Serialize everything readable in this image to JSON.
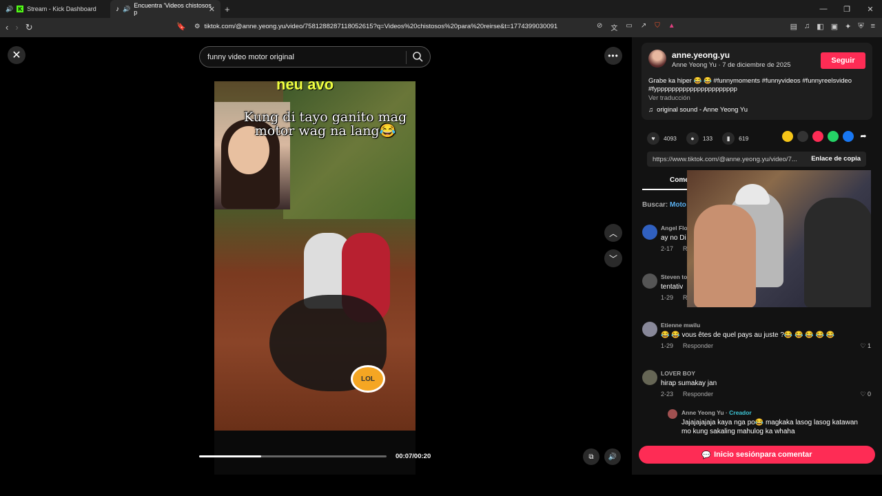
{
  "browser": {
    "tabs": [
      {
        "label": "Stream - Kick Dashboard",
        "icon": "kick-icon"
      },
      {
        "label": "Encuentra 'Videos chistosos p",
        "icon": "tiktok-icon"
      }
    ],
    "url": "tiktok.com/@anne.yeong.yu/video/7581288287118052615?q=Videos%20chistosos%20para%20reirse&t=1774399030091"
  },
  "player": {
    "search_value": "funny video motor original",
    "video_top_caption": "neu avo",
    "video_caption": "Kung di tayo ganito mag motor wag na lang😂",
    "time": "00:07/00:20",
    "progress_fraction": 0.33,
    "sticker_text": "LOL"
  },
  "panel": {
    "username": "anne.yeong.yu",
    "meta": "Anne Yeong Yu · 7 de diciembre de 2025",
    "follow_label": "Seguir",
    "description": "Grabe ka hiper 😂 😂 #funnymoments #funnyvideos #funnyreelsvideo #fypppppppppppppppppppppp",
    "translate_label": "Ver traducción",
    "sound": "original sound - Anne Yeong Yu",
    "likes": "4093",
    "comments": "133",
    "saves": "619",
    "link": "https://www.tiktok.com/@anne.yeong.yu/video/7...",
    "copy_label": "Enlace de copia",
    "tab_label": "Come",
    "search_prefix": "Buscar:",
    "search_term": "Moto",
    "comment_list": [
      {
        "author": "Angel Flo",
        "text": "ay no Di",
        "date": "2-17",
        "reply": "Res",
        "likes": ""
      },
      {
        "author": "Steven to",
        "text": "tentativ",
        "date": "1-29",
        "reply": "Res",
        "likes": ""
      },
      {
        "author": "Etienne mwilu",
        "text": "😂 😂 vous êtes de quel pays au juste ?😂 😂 😂 😂 😂",
        "date": "1-29",
        "reply": "Responder",
        "likes": "1"
      },
      {
        "author": "LOVER BOY",
        "text": "hirap sumakay jan",
        "date": "2-23",
        "reply": "Responder",
        "likes": "0"
      }
    ],
    "creator_reply": {
      "author": "Anne Yeong Yu",
      "tag": "Creador",
      "text": "Jajajajajaja kaya nga po😂 magkaka lasog lasog katawan mo kung sakaling mahulog ka whaha"
    },
    "login_label": "Inicio sesiónpara comentar"
  },
  "colors": {
    "accent": "#fe2c55",
    "creator": "#3ec8d8",
    "link": "#5ab0f0"
  }
}
